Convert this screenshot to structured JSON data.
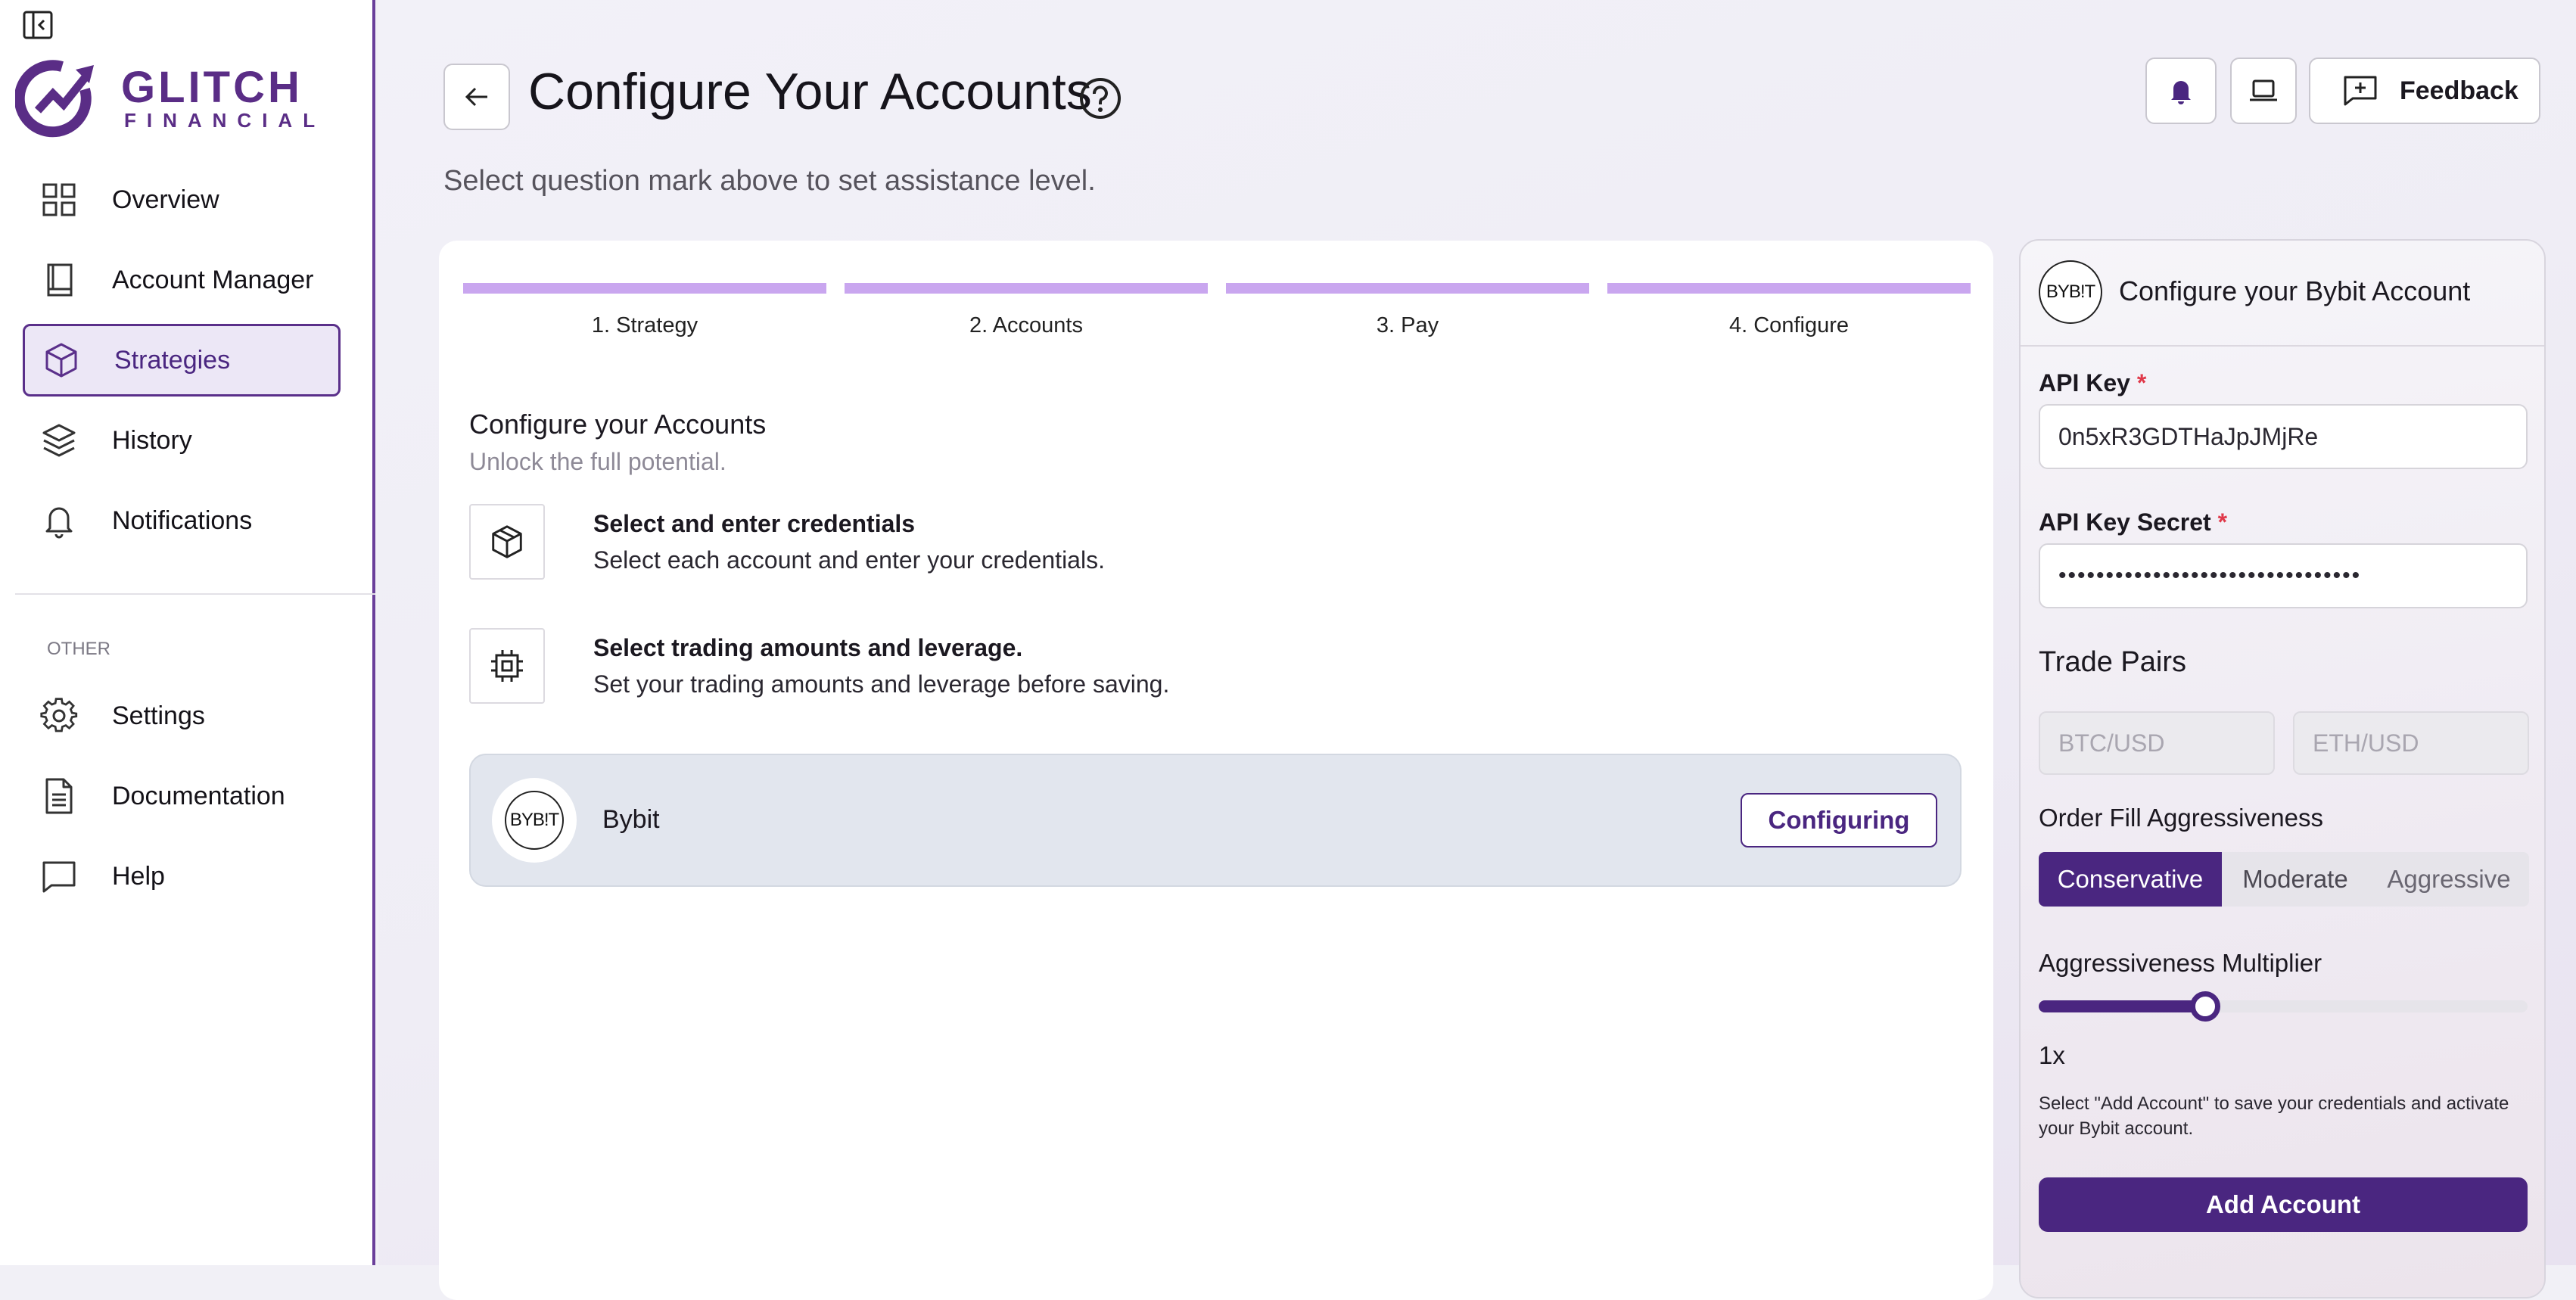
{
  "sidebar": {
    "brand": {
      "name": "GLITCH",
      "sub": "FINANCIAL"
    },
    "nav": [
      {
        "label": "Overview",
        "icon": "grid-icon"
      },
      {
        "label": "Account Manager",
        "icon": "book-icon"
      },
      {
        "label": "Strategies",
        "icon": "cube-icon",
        "active": true
      },
      {
        "label": "History",
        "icon": "layers-icon"
      },
      {
        "label": "Notifications",
        "icon": "bell-icon"
      }
    ],
    "other_heading": "OTHER",
    "other": [
      {
        "label": "Settings",
        "icon": "gear-icon"
      },
      {
        "label": "Documentation",
        "icon": "document-icon"
      },
      {
        "label": "Help",
        "icon": "message-icon"
      }
    ]
  },
  "header": {
    "title": "Configure Your Accounts",
    "subtitle": "Select question mark above to set assistance level.",
    "feedback_label": "Feedback"
  },
  "steps": [
    "1. Strategy",
    "2. Accounts",
    "3. Pay",
    "4. Configure"
  ],
  "main": {
    "section_title": "Configure your Accounts",
    "section_subtitle": "Unlock the full potential.",
    "instructions": [
      {
        "title": "Select and enter credentials",
        "desc": "Select each account and enter your credentials.",
        "icon": "cube-icon"
      },
      {
        "title": "Select trading amounts and leverage.",
        "desc": "Set your trading amounts and leverage before saving.",
        "icon": "chip-icon"
      }
    ],
    "exchange": {
      "name": "Bybit",
      "logo_text": "BYB!T",
      "status": "Configuring"
    }
  },
  "panel": {
    "title": "Configure your Bybit Account",
    "logo_text": "BYB!T",
    "api_key_label": "API Key",
    "api_key_value": "0n5xR3GDTHaJpJMjRe",
    "api_secret_label": "API Key Secret",
    "api_secret_value": "••••••••••••••••••••••••••••••••",
    "required_mark": "*",
    "trade_pairs_label": "Trade Pairs",
    "trade_pairs_placeholders": [
      "BTC/USD",
      "ETH/USD"
    ],
    "aggressiveness_label": "Order Fill Aggressiveness",
    "aggressiveness_options": [
      "Conservative",
      "Moderate",
      "Aggressive"
    ],
    "aggressiveness_selected": "Conservative",
    "multiplier_label": "Aggressiveness Multiplier",
    "multiplier_fraction": 0.34,
    "multiplier_value": "1x",
    "help_text": "Select \"Add Account\" to save your credentials and activate your Bybit account.",
    "add_button": "Add Account"
  },
  "colors": {
    "accent": "#4a2680",
    "step": "#c9a6ef",
    "required": "#e0394a"
  }
}
